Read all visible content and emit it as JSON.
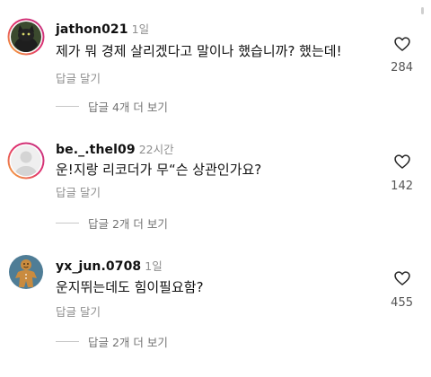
{
  "comments": [
    {
      "username": "jathon021",
      "time": "1일",
      "text": "제가 뭐 경제 살리겠다고 말이나 했습니까? 했는데!",
      "reply_label": "답글 달기",
      "likes": "284",
      "view_replies": "답글 4개 더 보기",
      "avatar": "cat-avatar"
    },
    {
      "username": "be._.thel09",
      "time": "22시간",
      "text": "운!지랑 리코더가 무“슨 상관인가요?",
      "reply_label": "답글 달기",
      "likes": "142",
      "view_replies": "답글 2개 더 보기",
      "avatar": "default-avatar"
    },
    {
      "username": "yx_jun.0708",
      "time": "1일",
      "text": "운지뛰는데도 힘이필요함?",
      "reply_label": "답글 달기",
      "likes": "455",
      "view_replies": "답글 2개 더 보기",
      "avatar": "gingerbread-avatar"
    }
  ]
}
